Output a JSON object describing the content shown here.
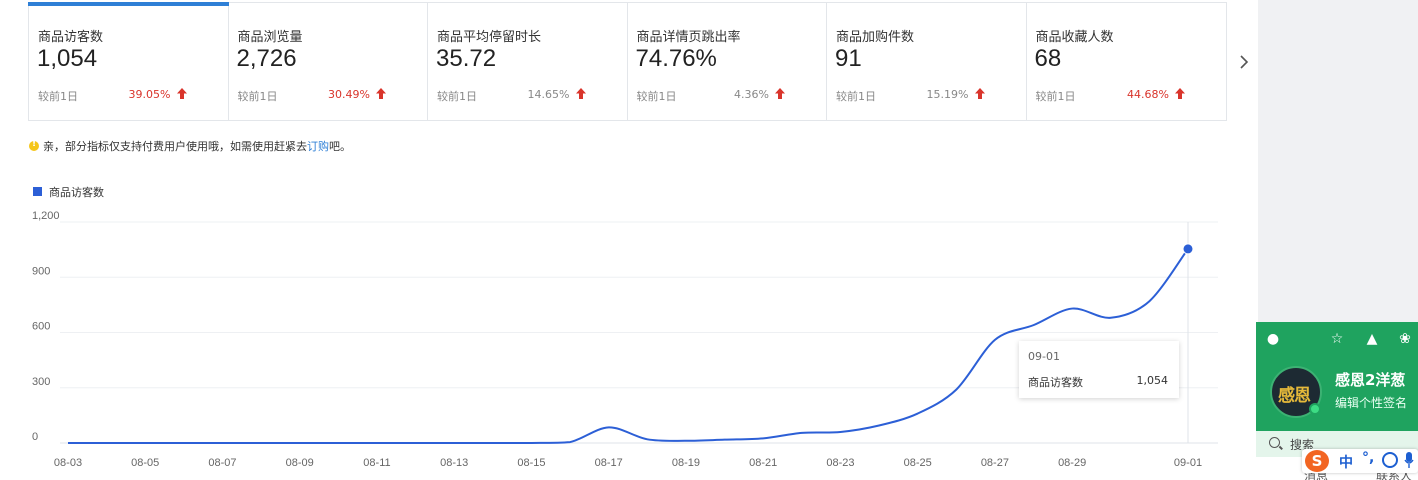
{
  "metrics": [
    {
      "label": "商品访客数",
      "value": "1,054",
      "compare": "较前1日",
      "change": "39.05%",
      "trend": "up",
      "highlight": true
    },
    {
      "label": "商品浏览量",
      "value": "2,726",
      "compare": "较前1日",
      "change": "30.49%",
      "trend": "up",
      "highlight": true
    },
    {
      "label": "商品平均停留时长",
      "value": "35.72",
      "compare": "较前1日",
      "change": "14.65%",
      "trend": "up",
      "highlight": false
    },
    {
      "label": "商品详情页跳出率",
      "value": "74.76%",
      "compare": "较前1日",
      "change": "4.36%",
      "trend": "up",
      "highlight": false
    },
    {
      "label": "商品加购件数",
      "value": "91",
      "compare": "较前1日",
      "change": "15.19%",
      "trend": "up",
      "highlight": false
    },
    {
      "label": "商品收藏人数",
      "value": "68",
      "compare": "较前1日",
      "change": "44.68%",
      "trend": "up",
      "highlight": true
    }
  ],
  "notice": {
    "text": "亲，部分指标仅支持付费用户使用哦，如需使用赶紧去",
    "link": "订购",
    "suffix": "吧。"
  },
  "colors": {
    "accent": "#2e7fd6",
    "series": "#2c5fd6",
    "up_red": "#d9342b",
    "qq_green": "#1fa35f"
  },
  "chart_data": {
    "type": "line",
    "series": [
      {
        "name": "商品访客数",
        "values": [
          0,
          0,
          0,
          0,
          0,
          0,
          0,
          0,
          0,
          0,
          0,
          0,
          0,
          5,
          85,
          20,
          12,
          18,
          25,
          55,
          60,
          95,
          160,
          290,
          560,
          640,
          730,
          680,
          770,
          1054
        ]
      }
    ],
    "x": [
      "08-03",
      "08-04",
      "08-05",
      "08-06",
      "08-07",
      "08-08",
      "08-09",
      "08-10",
      "08-11",
      "08-12",
      "08-13",
      "08-14",
      "08-15",
      "08-16",
      "08-17",
      "08-18",
      "08-19",
      "08-20",
      "08-21",
      "08-22",
      "08-23",
      "08-24",
      "08-25",
      "08-26",
      "08-27",
      "08-28",
      "08-29",
      "08-30",
      "08-31",
      "09-01"
    ],
    "x_tick_labels": [
      "08-03",
      "08-05",
      "08-07",
      "08-09",
      "08-11",
      "08-13",
      "08-15",
      "08-17",
      "08-19",
      "08-21",
      "08-23",
      "08-25",
      "08-27",
      "08-29",
      "09-01"
    ],
    "y_ticks": [
      "0",
      "300",
      "600",
      "900",
      "1,200"
    ],
    "ylim": [
      0,
      1200
    ],
    "grid": true,
    "legend": "top-left"
  },
  "tooltip": {
    "date": "09-01",
    "name": "商品访客数",
    "value": "1,054"
  },
  "qq_panel": {
    "nickname": "感恩2洋葱",
    "signature": "编辑个性签名",
    "search_placeholder": "搜索",
    "tabs": [
      "消息",
      "联系人"
    ],
    "avatar_text": "感恩"
  },
  "ime": {
    "logo": "S",
    "mode": "中",
    "punct": "°,"
  }
}
